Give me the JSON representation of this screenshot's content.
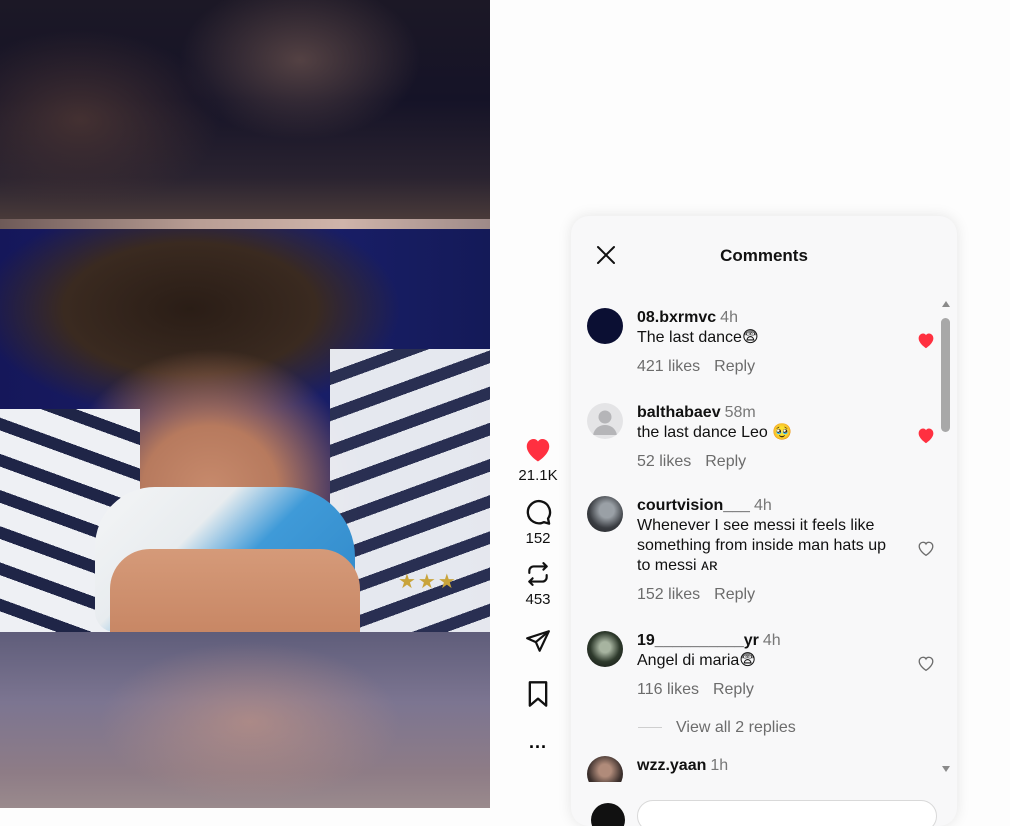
{
  "video": {},
  "actions": {
    "likes": "21.1K",
    "comments": "152",
    "reposts": "453",
    "more": "..."
  },
  "panel": {
    "title": "Comments",
    "comments": [
      {
        "user": "08.bxrmvc",
        "time": "4h",
        "text": "The last dance😨",
        "likes": "421 likes",
        "reply": "Reply",
        "liked": true
      },
      {
        "user": "balthabaev",
        "time": "58m",
        "text": "the last dance Leo 🥹",
        "likes": "52 likes",
        "reply": "Reply",
        "liked": true
      },
      {
        "user": "courtvision___",
        "time": "4h",
        "text": "Whenever I see messi it feels like something from inside man hats up to messi ᴀʀ",
        "likes": "152 likes",
        "reply": "Reply",
        "liked": false
      },
      {
        "user": "19__________yr",
        "time": "4h",
        "text": "Angel di maria😨",
        "likes": "116 likes",
        "reply": "Reply",
        "liked": false
      },
      {
        "user": "wzz.yaan",
        "time": "1h",
        "text": "",
        "likes": "",
        "reply": "",
        "liked": false
      }
    ],
    "view_replies": "View all 2 replies"
  },
  "colors": {
    "like_red": "#ff3040",
    "panel_bg": "#f8f8f9",
    "muted_text": "#6c6c6c"
  }
}
